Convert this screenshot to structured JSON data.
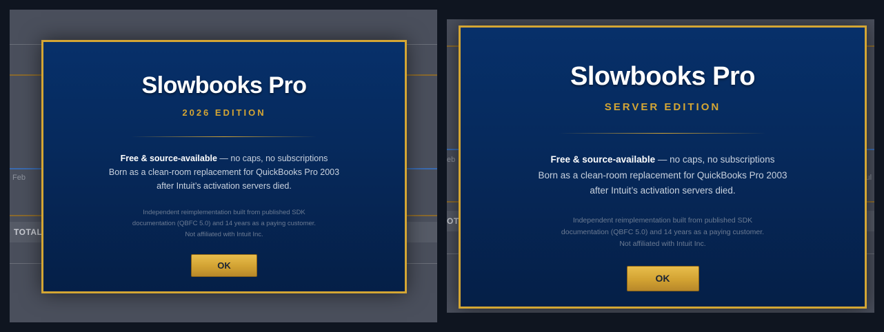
{
  "screens": [
    {
      "background": {
        "month_left": "Feb",
        "total_label": "TOTAL"
      },
      "dialog": {
        "title": "Slowbooks Pro",
        "edition": "2026 EDITION",
        "desc_bold": "Free & source-available",
        "desc_rest": " — no caps, no subscriptions",
        "desc_line2": "Born as a clean-room replacement for QuickBooks Pro 2003",
        "desc_line3": "after Intuit’s activation servers died.",
        "fine_line1": "Independent reimplementation built from published SDK",
        "fine_line2": "documentation (QBFC 5.0) and 14 years as a paying customer.",
        "fine_line3": "Not affiliated with Intuit Inc.",
        "ok_label": "OK"
      }
    },
    {
      "background": {
        "month_left": "eb",
        "month_right": "Jul",
        "total_label": "OT"
      },
      "dialog": {
        "title": "Slowbooks Pro",
        "edition": "SERVER EDITION",
        "desc_bold": "Free & source-available",
        "desc_rest": " — no caps, no subscriptions",
        "desc_line2": "Born as a clean-room replacement for QuickBooks Pro 2003",
        "desc_line3": "after Intuit’s activation servers died.",
        "fine_line1": "Independent reimplementation built from published SDK",
        "fine_line2": "documentation (QBFC 5.0) and 14 years as a paying customer.",
        "fine_line3": "Not affiliated with Intuit Inc.",
        "ok_label": "OK"
      }
    }
  ],
  "colors": {
    "accent_gold": "#d4a634",
    "dialog_navy": "#062a5d",
    "page_bg": "#0f1520"
  }
}
